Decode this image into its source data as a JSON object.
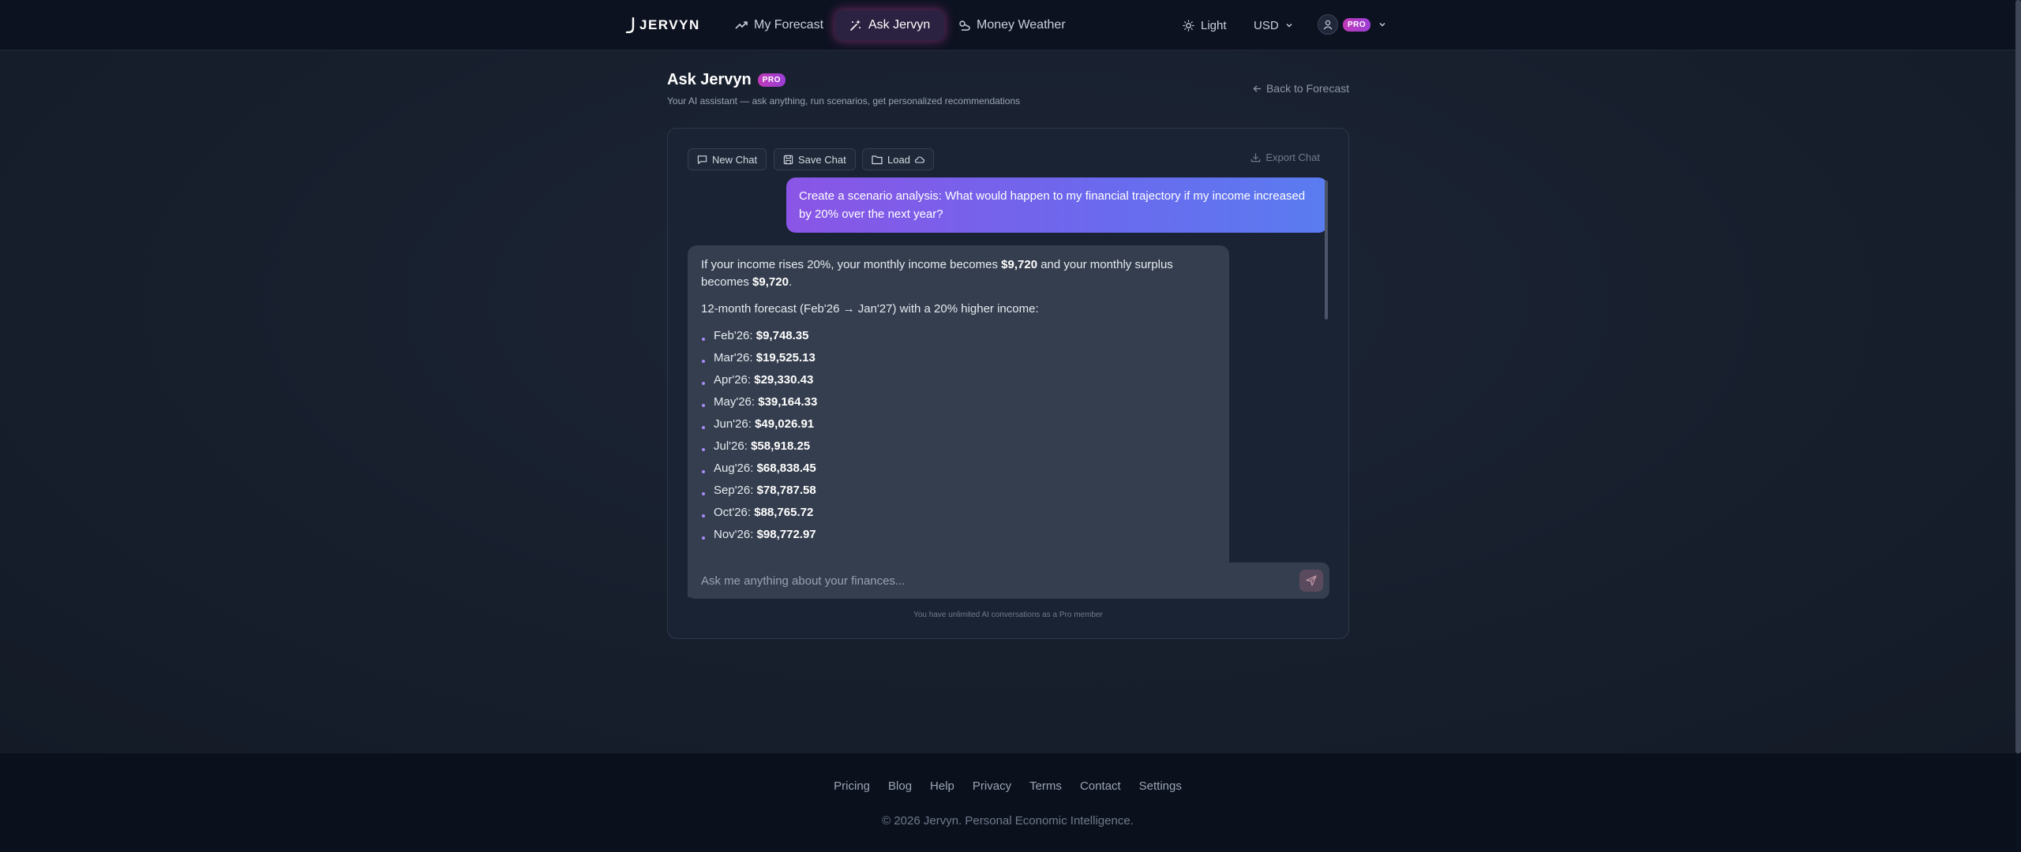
{
  "brand": {
    "name": "JERVYN"
  },
  "nav": {
    "items": [
      {
        "label": "My Forecast",
        "icon": "trending-up-icon"
      },
      {
        "label": "Ask Jervyn",
        "icon": "sparkle-icon",
        "active": true
      },
      {
        "label": "Money Weather",
        "icon": "weather-icon"
      }
    ],
    "theme_label": "Light",
    "currency_label": "USD",
    "pro_badge": "PRO"
  },
  "page": {
    "title": "Ask Jervyn",
    "title_badge": "PRO",
    "subtitle": "Your AI assistant — ask anything, run scenarios, get personalized recommendations",
    "back_label": "Back to Forecast"
  },
  "toolbar": {
    "new_chat": "New Chat",
    "save_chat": "Save Chat",
    "load": "Load",
    "export_chat": "Export Chat"
  },
  "conversation": {
    "user_message": "Create a scenario analysis: What would happen to my financial trajectory if my income increased by 20% over the next year?",
    "ai_intro_1": "If your income rises 20%, your monthly income becomes ",
    "ai_income": "$9,720",
    "ai_intro_2": " and your monthly surplus becomes ",
    "ai_surplus": "$9,720",
    "ai_intro_3": ".",
    "ai_forecast_heading": "12-month forecast (Feb'26 → Jan'27) with a 20% higher income:",
    "forecast": [
      {
        "month": "Feb'26",
        "value": "$9,748.35"
      },
      {
        "month": "Mar'26",
        "value": "$19,525.13"
      },
      {
        "month": "Apr'26",
        "value": "$29,330.43"
      },
      {
        "month": "May'26",
        "value": "$39,164.33"
      },
      {
        "month": "Jun'26",
        "value": "$49,026.91"
      },
      {
        "month": "Jul'26",
        "value": "$58,918.25"
      },
      {
        "month": "Aug'26",
        "value": "$68,838.45"
      },
      {
        "month": "Sep'26",
        "value": "$78,787.58"
      },
      {
        "month": "Oct'26",
        "value": "$88,765.72"
      },
      {
        "month": "Nov'26",
        "value": "$98,772.97"
      }
    ]
  },
  "input": {
    "placeholder": "Ask me anything about your finances...",
    "member_note": "You have unlimited AI conversations as a Pro member"
  },
  "footer": {
    "links": [
      "Pricing",
      "Blog",
      "Help",
      "Privacy",
      "Terms",
      "Contact",
      "Settings"
    ],
    "copyright": "© 2026 Jervyn. Personal Economic Intelligence."
  },
  "colors": {
    "accent_purple": "#8a55e6",
    "accent_blue": "#5a7cf0",
    "pro_magenta": "#c03ab8",
    "background": "#151c2a"
  }
}
